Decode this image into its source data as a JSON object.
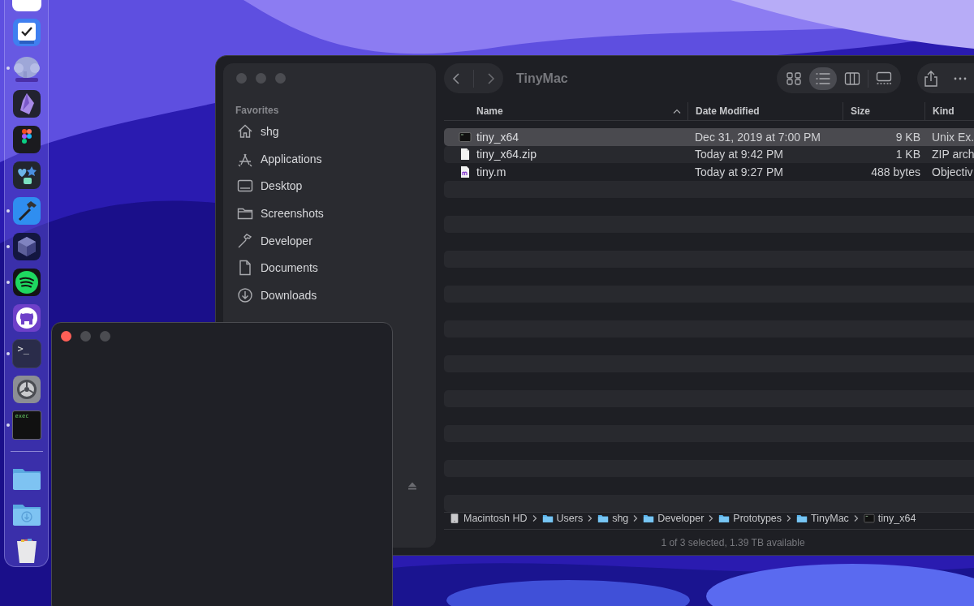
{
  "dock": {
    "items": [
      {
        "kind": "calendar"
      },
      {
        "kind": "checklist",
        "running": false
      },
      {
        "kind": "elephant",
        "running": true
      },
      {
        "kind": "crystal",
        "running": false
      },
      {
        "kind": "shapes",
        "running": false
      },
      {
        "kind": "heart-star",
        "running": false
      },
      {
        "kind": "hammer",
        "running": true
      },
      {
        "kind": "cube",
        "running": true
      },
      {
        "kind": "waves",
        "running": true
      },
      {
        "kind": "cat",
        "running": false
      },
      {
        "kind": "terminal",
        "running": true,
        "prompt": ">_"
      },
      {
        "kind": "gear",
        "running": false
      },
      {
        "kind": "console",
        "running": true,
        "text": "exec"
      },
      {
        "kind": "separator"
      },
      {
        "kind": "folder",
        "running": false
      },
      {
        "kind": "download-folder",
        "running": false
      },
      {
        "kind": "trash",
        "running": false
      }
    ]
  },
  "finder": {
    "title": "TinyMac",
    "traffic_lights": [
      {
        "color": "#4b4c51"
      },
      {
        "color": "#4b4c51"
      },
      {
        "color": "#4b4c51"
      }
    ],
    "view_modes": [
      {
        "kind": "icons",
        "selected": false
      },
      {
        "kind": "list",
        "selected": true
      },
      {
        "kind": "columns",
        "selected": false
      },
      {
        "kind": "gallery",
        "selected": false
      }
    ],
    "sidebar": {
      "heading": "Favorites",
      "items": [
        {
          "kind": "home",
          "label": "shg"
        },
        {
          "kind": "apps",
          "label": "Applications"
        },
        {
          "kind": "desktop",
          "label": "Desktop"
        },
        {
          "kind": "folder",
          "label": "Screenshots"
        },
        {
          "kind": "hammer",
          "label": "Developer"
        },
        {
          "kind": "document",
          "label": "Documents"
        },
        {
          "kind": "download",
          "label": "Downloads"
        }
      ]
    },
    "columns": [
      {
        "label": "Name",
        "sorted": true
      },
      {
        "label": "Date Modified",
        "sorted": false
      },
      {
        "label": "Size",
        "sorted": false
      },
      {
        "label": "Kind",
        "sorted": false
      }
    ],
    "rows": [
      {
        "kind": "exec",
        "name": "tiny_x64",
        "date": "Dec 31, 2019 at 7:00 PM",
        "size": "9 KB",
        "type": "Unix Ex.",
        "selected": true
      },
      {
        "kind": "zip",
        "name": "tiny_x64.zip",
        "date": "Today at 9:42 PM",
        "size": "1 KB",
        "type": "ZIP arch",
        "selected": false
      },
      {
        "kind": "source",
        "name": "tiny.m",
        "date": "Today at 9:27 PM",
        "size": "488 bytes",
        "type": "Objectiv",
        "selected": false
      }
    ],
    "path": [
      {
        "kind": "disk",
        "label": "Macintosh HD"
      },
      {
        "kind": "folder",
        "label": "Users"
      },
      {
        "kind": "folder",
        "label": "shg"
      },
      {
        "kind": "folder",
        "label": "Developer"
      },
      {
        "kind": "folder",
        "label": "Prototypes"
      },
      {
        "kind": "folder",
        "label": "TinyMac"
      },
      {
        "kind": "exec",
        "label": "tiny_x64"
      }
    ],
    "status": "1 of 3 selected, 1.39 TB available"
  },
  "small_window": {
    "traffic_lights": [
      {
        "color": "#ff5f57"
      },
      {
        "color": "#4b4c51"
      },
      {
        "color": "#4b4c51"
      }
    ]
  }
}
